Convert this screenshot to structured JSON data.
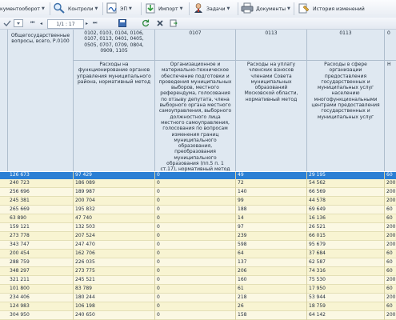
{
  "toolbar": {
    "docflow_label": "кументооборот",
    "controls_label": "Контроли",
    "ep_label": "ЭП",
    "import_label": "Импорт",
    "tasks_label": "Задачи",
    "documents_label": "Документы",
    "history_label": "История изменений"
  },
  "subbar": {
    "pager": "1/1 : 17"
  },
  "header": {
    "col1_title": "Общегосударственные вопросы, всего, Р.0100",
    "col2_codes": "0102, 0103, 0104, 0106, 0107, 0113, 0401, 0405, 0505, 0707, 0709, 0804, 0909, 1105",
    "col2_desc": "Расходы на функционирование органов управления муниципального района, нормативный метод",
    "col3_code": "0107",
    "col3_desc": "Организационное и материально-техническое обеспечение подготовки и проведения муниципальных выборов, местного референдума, голосования по отзыву депутата, члена выборного органа местного самоуправления, выборного должностного лица местного самоуправления, голосования по вопросам изменения границ муниципального образования, преобразования муниципального образования (пп.5 п. 1 ст.17), нормативный метод",
    "col4_code": "0113",
    "col4_desc": "Расходы на уплату членских взносов членами Совета муниципальных образований Московской области, нормативный метод",
    "col5_code": "0113",
    "col5_desc": "Расходы в сфере организации предоставления государственных и муниципальных услуг населению многофункциональными центрами предоставления государственных и муниципальных услуг",
    "col6_code": "0",
    "col6_desc": "Н"
  },
  "rows": [
    {
      "c1": "126 673",
      "c2": "97 429",
      "c3": "0",
      "c4": "49",
      "c5": "29 195",
      "c6": "60"
    },
    {
      "c1": "240 723",
      "c2": "186 089",
      "c3": "0",
      "c4": "72",
      "c5": "54 562",
      "c6": "200"
    },
    {
      "c1": "256 696",
      "c2": "189 987",
      "c3": "0",
      "c4": "140",
      "c5": "66 569",
      "c6": "200"
    },
    {
      "c1": "245 381",
      "c2": "200 704",
      "c3": "0",
      "c4": "99",
      "c5": "44 578",
      "c6": "200"
    },
    {
      "c1": "265 669",
      "c2": "195 832",
      "c3": "0",
      "c4": "188",
      "c5": "69 649",
      "c6": "60"
    },
    {
      "c1": "63 890",
      "c2": "47 740",
      "c3": "0",
      "c4": "14",
      "c5": "16 136",
      "c6": "60"
    },
    {
      "c1": "159 121",
      "c2": "132 503",
      "c3": "0",
      "c4": "97",
      "c5": "26 521",
      "c6": "200"
    },
    {
      "c1": "273 778",
      "c2": "207 524",
      "c3": "0",
      "c4": "239",
      "c5": "66 015",
      "c6": "200"
    },
    {
      "c1": "343 747",
      "c2": "247 470",
      "c3": "0",
      "c4": "598",
      "c5": "95 679",
      "c6": "200"
    },
    {
      "c1": "200 454",
      "c2": "162 706",
      "c3": "0",
      "c4": "64",
      "c5": "37 684",
      "c6": "60"
    },
    {
      "c1": "288 759",
      "c2": "226 035",
      "c3": "0",
      "c4": "137",
      "c5": "62 587",
      "c6": "60"
    },
    {
      "c1": "348 297",
      "c2": "273 775",
      "c3": "0",
      "c4": "206",
      "c5": "74 316",
      "c6": "60"
    },
    {
      "c1": "321 211",
      "c2": "245 521",
      "c3": "0",
      "c4": "160",
      "c5": "75 530",
      "c6": "200"
    },
    {
      "c1": "101 800",
      "c2": "83 789",
      "c3": "0",
      "c4": "61",
      "c5": "17 950",
      "c6": "60"
    },
    {
      "c1": "234 406",
      "c2": "180 244",
      "c3": "0",
      "c4": "218",
      "c5": "53 944",
      "c6": "200"
    },
    {
      "c1": "124 983",
      "c2": "106 198",
      "c3": "0",
      "c4": "26",
      "c5": "18 759",
      "c6": "60"
    },
    {
      "c1": "304 950",
      "c2": "240 650",
      "c3": "0",
      "c4": "158",
      "c5": "64 142",
      "c6": "200"
    }
  ]
}
